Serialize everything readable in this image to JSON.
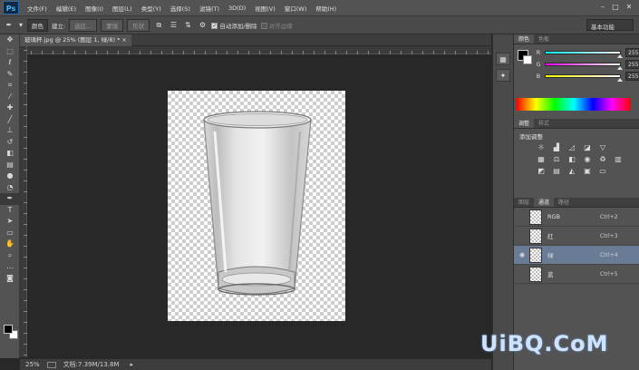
{
  "app": {
    "logo": "Ps"
  },
  "menu": [
    "文件(F)",
    "编辑(E)",
    "图像(I)",
    "图层(L)",
    "类型(Y)",
    "选择(S)",
    "滤镜(T)",
    "3D(D)",
    "视图(V)",
    "窗口(W)",
    "帮助(H)"
  ],
  "window_controls": {
    "minimize": "–",
    "maximize": "□",
    "close": "✕"
  },
  "options_bar": {
    "brush_mode": "颜色",
    "create_label": "建立:",
    "selection_btn": "选区...",
    "mask_btn": "蒙版",
    "shape_btn": "形状",
    "auto_add_delete": "自动添加/删除",
    "align_edges": "对齐边缘",
    "workspace": "基本功能"
  },
  "document_tab": {
    "title": "玻璃杯.jpg @ 25% (图层 1, 绿/8) *",
    "close": "×"
  },
  "status_bar": {
    "zoom": "25%",
    "doc_info": "文档:7.39M/13.8M"
  },
  "tools": [
    "move",
    "marquee",
    "lasso",
    "quick-select",
    "crop",
    "eyedropper",
    "healing",
    "brush",
    "stamp",
    "history-brush",
    "eraser",
    "gradient",
    "blur",
    "dodge",
    "pen",
    "type",
    "path-select",
    "shape",
    "hand",
    "zoom"
  ],
  "color_panel": {
    "tabs": [
      "颜色",
      "色板"
    ],
    "channels": [
      {
        "label": "R",
        "value": "255",
        "gradient": "linear-gradient(to right,#00ffff,#ffffff)"
      },
      {
        "label": "G",
        "value": "255",
        "gradient": "linear-gradient(to right,#ff00ff,#ffffff)"
      },
      {
        "label": "B",
        "value": "255",
        "gradient": "linear-gradient(to right,#ffff00,#ffffff)"
      }
    ]
  },
  "adjust_panel": {
    "tabs": [
      "调整",
      "样式"
    ],
    "title": "添加调整"
  },
  "channels_panel": {
    "tabs": [
      "图层",
      "通道",
      "路径"
    ],
    "rows": [
      {
        "name": "RGB",
        "shortcut": "Ctrl+2",
        "visible": false,
        "selected": false
      },
      {
        "name": "红",
        "shortcut": "Ctrl+3",
        "visible": false,
        "selected": false
      },
      {
        "name": "绿",
        "shortcut": "Ctrl+4",
        "visible": true,
        "selected": true
      },
      {
        "name": "蓝",
        "shortcut": "Ctrl+5",
        "visible": false,
        "selected": false
      }
    ]
  },
  "watermark": "UiBQ.CoM"
}
